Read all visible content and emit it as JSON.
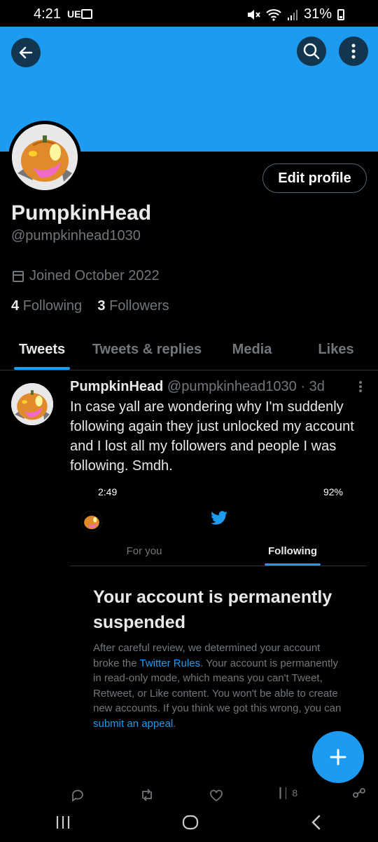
{
  "status_bar": {
    "time": "4:21",
    "carrier": "UE",
    "battery": "31%",
    "icons": [
      "image-icon",
      "mute-icon",
      "wifi-icon",
      "signal-icon",
      "battery-icon"
    ]
  },
  "header": {
    "back_icon": "back-arrow-icon",
    "search_icon": "search-icon",
    "more_icon": "more-vertical-icon",
    "banner_color": "#1d9bf0"
  },
  "profile": {
    "display_name": "PumpkinHead",
    "handle": "@pumpkinhead1030",
    "joined": "Joined October 2022",
    "following_count": "4",
    "following_label": "Following",
    "followers_count": "3",
    "followers_label": "Followers",
    "edit_button": "Edit profile"
  },
  "tabs": [
    {
      "label": "Tweets",
      "active": true
    },
    {
      "label": "Tweets & replies",
      "active": false
    },
    {
      "label": "Media",
      "active": false
    },
    {
      "label": "Likes",
      "active": false
    }
  ],
  "tweet": {
    "author_name": "PumpkinHead",
    "author_handle": "@pumpkinhead1030",
    "separator": "·",
    "age": "3d",
    "text": "In case yall are wondering why I'm suddenly following again they just unlocked my account and I lost all my followers and people I was following. Smdh.",
    "actions": {
      "views": "8"
    }
  },
  "embedded_screenshot": {
    "time": "2:49",
    "battery": "92%",
    "tabs": [
      {
        "label": "For you",
        "active": false
      },
      {
        "label": "Following",
        "active": true
      }
    ],
    "title": "Your account is permanently suspended",
    "body_before_link1": "After careful review, we determined your account broke the ",
    "link1": "Twitter Rules",
    "body_middle": ". Your account is permanently in read-only mode, which means you can't Tweet, Retweet, or Like content. You won't be able to create new accounts. If you think we got this wrong, you can ",
    "link2": "submit an appeal",
    "body_end": "."
  },
  "fab": {
    "icon": "plus-icon"
  },
  "nav": {
    "icons": [
      "recents-icon",
      "home-icon",
      "back-icon"
    ]
  },
  "colors": {
    "accent": "#1d9bf0",
    "muted": "#71767b",
    "text": "#e7e9ea"
  }
}
